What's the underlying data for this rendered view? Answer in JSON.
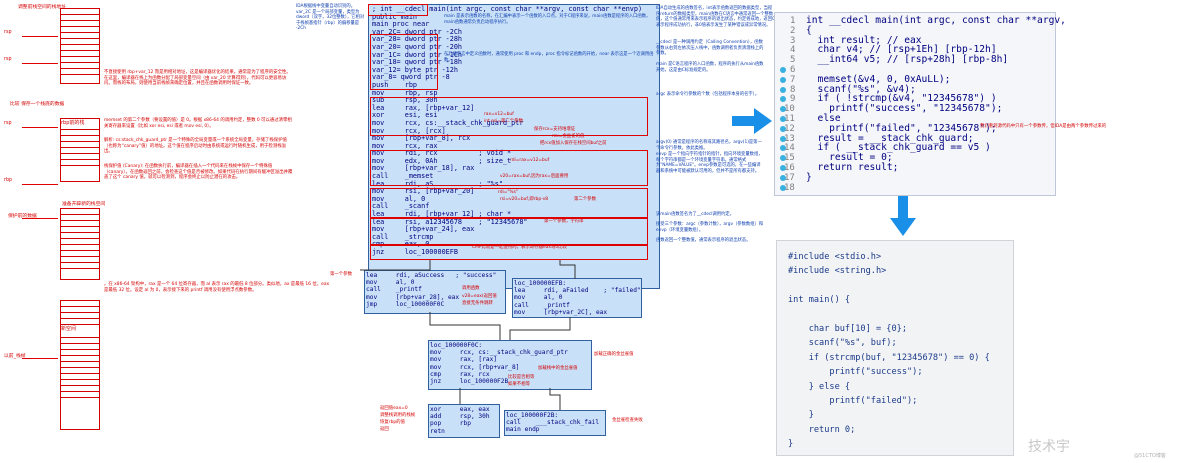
{
  "stack_labels": {
    "top_rsp": "rsp",
    "top_note": "调整前栈空间的栈地址",
    "region_rsp_1": "rsp",
    "region_rsp_2": "rsp",
    "prev_frame": "以前_栈帧",
    "stack_regions": [
      "rbp前的栈",
      "rbp的栈",
      "rbp",
      "准备开辟新的栈空间"
    ]
  },
  "left_notes": {
    "note1": "不直接使用 rbp+var_12 而是用相对地址，这是编译器优化的结果。通常是为了程序的安全性。在这里，编译器在栈上为函数分配了局部变量空间（由 var_20 计算得到），代码可以更容易访问。而栈的布局，则使用当前栈帧来确定位置，并且在函数调用时保证一致。",
    "note2": "memset 的第二个参数（要设置的值）是 0。根据 x86-64 的调用约定，整数 0 可以通过清零相关寄存器来设置（比如 xor esi, esi 或者 mov esi, 0）。",
    "note3": "解析: cs:stack_chk_guard_ptr 是一个特殊的全局变量或一个系统全局变量，存储了栈保护值（也称为“canary”值）的地址。这个值在程序启动时由系统或运行时随机生成，用于检测栈溢出。",
    "note4": "栈保护值 (Canary): 在函数执行前，编译器在插入一个代码来在栈帧中保存一个特殊值（canary）。在函数返回之前，会检查这个值是否被修改。如果代码在执行期间有缓冲区溢出并覆盖了这个 canary 值，就可以检测到，程序会终止以防止潜在的攻击。",
    "note5": "。在 x86-64 架构中，rax 是一个 64 位寄存器，而 al 表示 rax 的最低 8 位部分。类似地，ax 是最低 16 位，eax 是最低 32 位。设定 al 为 0，表示接下来的 printf 调用没有使用浮点数参数。",
    "stack_arrow_1": "比较 保存一个栈底的数据",
    "stack_arrow_2": "保护前的数据",
    "boxes": [
      "rbp前的栈",
      "rbp的栈",
      "新空间"
    ]
  },
  "asm_top": {
    "lines": [
      "; int __cdecl main(int argc, const char **argv, const char **envp)",
      "public main",
      "main proc near",
      "",
      "var_2C= dword ptr -2Ch",
      "var_28= dword ptr -28h",
      "var_20= qword ptr -20h",
      "var_1C= dword ptr -1Ch",
      "var_18= qword ptr -18h",
      "var_12= byte ptr -12h",
      "var_8= qword ptr -8",
      "",
      "push    rbp",
      "mov     rbp, rsp",
      "sub     rsp, 30h",
      "lea     rax, [rbp+var_12]",
      "xor     esi, esi",
      "mov     rcx, cs:__stack_chk_guard_ptr",
      "mov     rcx, [rcx]",
      "mov     [rbp+var_8], rcx",
      "mov     rcx, rax",
      "mov     rdi, rcx          ; void *",
      "mov     edx, 0Ah          ; size_t",
      "mov     [rbp+var_18], rax",
      "call    _memset",
      "lea     rdi, aS           ; \"%s\"",
      "mov     rsi, [rbp+var_20]",
      "mov     al, 0",
      "call    _scanf",
      "lea     rdi, [rbp+var_12] ; char *",
      "lea     rsi, a12345678    ; \"12345678\"",
      "mov     [rbp+var_24], eax",
      "call    _strcmp",
      "cmp     eax, 0",
      "jnz     loc_100000EFB"
    ]
  },
  "asm_inline_notes": {
    "n1": "rax=v12=buf",
    "n2": "int esi=第二个参数",
    "n3": "保存rcx=支持堆增证",
    "n4": "rcx=金丝雀的值",
    "n5": "把rcx值加入保存在栈空间buf之前",
    "n6": "rdi=rax=v12=buf",
    "n7": "v20=rax=buf,因为rax=后面要用",
    "n8": "rdi=\"%s\"",
    "n9": "rsi=v20=buf,即rbp-v8",
    "n10": "第二个参数",
    "n11": "第一个参数，字符串",
    "n12": "CMP比较是一起使用的，表示寄存器eax与0比较"
  },
  "asm_left_block": {
    "lines": [
      "lea     rdi, aSuccess   ; \"success\"",
      "mov     al, 0",
      "call    _printf",
      "mov     [rbp+var_28], eax",
      "jmp     loc_100000F0C"
    ],
    "notes": [
      "第一个参数",
      "调用函数",
      "v28=eax(返回值",
      "直接无条件跳转"
    ]
  },
  "asm_right_block": {
    "lines": [
      "loc_100000EFB:",
      "lea     rdi, aFailed    ; \"failed\"",
      "mov     al, 0",
      "call    _printf",
      "mov     [rbp+var_2C], eax"
    ]
  },
  "asm_mid_block": {
    "lines": [
      "loc_100000F0C:",
      "mov     rcx, cs:__stack_chk_guard_ptr",
      "mov     rax, [rax]",
      "mov     rcx, [rbp+var_8]",
      "cmp     rax, rcx",
      "jnz     loc_100000F2B"
    ],
    "notes": [
      "加载正确的金丝雀值",
      "加载栈中的金丝雀值",
      "比较是否相等",
      "如果不相等"
    ]
  },
  "asm_bottom_left": {
    "lines": [
      "xor     eax, eax",
      "add     rsp, 30h",
      "pop     rbp",
      "retn"
    ],
    "notes": [
      "返回值eax=0",
      "调整栈调用的栈帧",
      "恢复rbp的值",
      "返回"
    ]
  },
  "asm_bottom_right": {
    "lines": [
      "loc_100000F2B:",
      "call    ___stack_chk_fail",
      "main endp"
    ],
    "notes": [
      "金丝雀检查失败"
    ]
  },
  "blue_notes": {
    "b1": "IDA自动生成的函数签名，int表示函数返回的数据类型，当程序return的数据类型，main函数在C语言中通常返回一个整数值，这个值通常用来表示程序的退出状态，约定俗成地，返回0表示程序成功执行，非0值表示发生了某种错误或异常情况。",
    "b2": "__cdecl 是一种调用约定（Calling Convention），函数参数从右到左依次压入栈中，函数调用者负责清理栈上的参数。",
    "b3": "main 是C语言程序的入口函数，程序的执行从main函数开始，这是由C标准规定的。",
    "b4": "argc 表示命令行参数的个数（包括程序本身的名字）。",
    "b5": "argv(0) 通常是程序的名称或其路径名，argv(1)是第一个命令行参数，依此类推。",
    "b6": "envp 是一个指向字符指针的指针，指向环境变量数组，每个字符串都是一个环境变量字符串，通常格式为\"NAME=VALUE\"。envp参数是可选的，在一些编译器和系统中可能被默认可用的，但并不是所有都支持。",
    "b7": "该main函数签名为了__cdecl调用约定。",
    "b8": "接受三个参数：argc（参数计数），argv（参数数组）和envp（环境变量数组）。",
    "b9": "函数返回一个整数值，通常表示程序的退出状态。",
    "asm_decl_note": "IDA根据栈中变量自动识别的。var_2C 是一个局部变量，类型为 dword（双字，32位整数），它相对于栈帧基指针（rbp）的偏移量是 -2Ch",
    "main_note": "main 是表示函数的名称，在汇编中表示一个函数的入口点，对于C程序来说，main函数是程序的入口函数，main函数通常负责启动程序执行。",
    "public_note": "在汇编语言中定义函数时，通常使用 proc 和 endp，proc 指令标记函数的开始，near 表示这是一个近调用函数。"
  },
  "decompiled": {
    "lines": [
      "int __cdecl main(int argc, const char **argv,",
      "{",
      "  int result; // eax",
      "  char v4; // [rsp+1Eh] [rbp-12h]",
      "  __int64 v5; // [rsp+28h] [rbp-8h]",
      "",
      "  memset(&v4, 0, 0xAuLL);",
      "  scanf(\"%s\", &v4);",
      "  if ( !strcmp(&v4, \"12345678\") )",
      "    printf(\"success\", \"12345678\");",
      "  else",
      "    printf(\"failed\", \"12345678\");",
      "  result = __stack_chk_guard;",
      "  if ( __stack_chk_guard == v5 )",
      "    result = 0;",
      "  return result;",
      "}",
      ""
    ],
    "line_numbers": [
      "1",
      "2",
      "3",
      "4",
      "5",
      "6",
      "7",
      "8",
      "9",
      "10",
      "11",
      "12",
      "13",
      "14",
      "15",
      "16",
      "17",
      "18"
    ],
    "side_note": "我们看到源代码中只有一个参数传，但IDA是由两个参数传过来的"
  },
  "source": {
    "lines": [
      "#include <stdio.h>",
      "#include <string.h>",
      "",
      "int main() {",
      "",
      "    char buf[10] = {0};",
      "    scanf(\"%s\", buf);",
      "    if (strcmp(buf, \"12345678\") == 0) {",
      "        printf(\"success\");",
      "    } else {",
      "        printf(\"failed\");",
      "    }",
      "    return 0;",
      "}"
    ]
  },
  "watermark": "技术宇",
  "watermark_small": "@51CTO博客",
  "colors": {
    "arrow_blue": "#1a8fe8",
    "red": "#d40000",
    "asm_bg": "#c8e0f8"
  }
}
